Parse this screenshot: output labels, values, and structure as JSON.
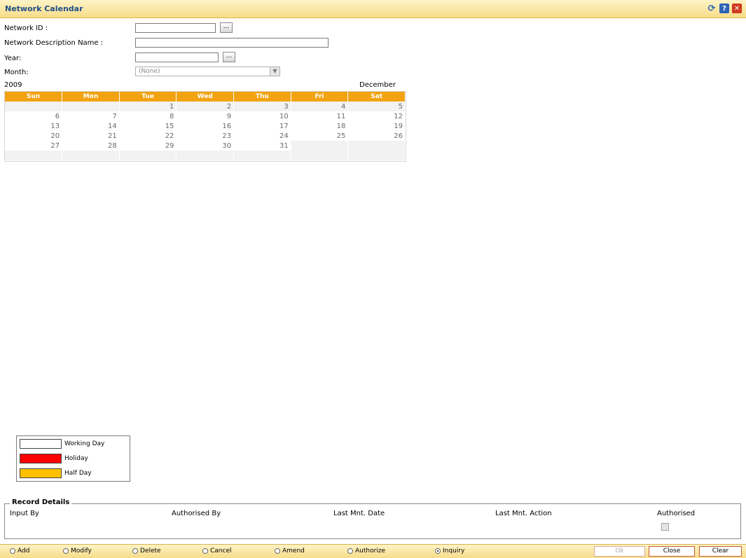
{
  "window": {
    "title": "Network Calendar"
  },
  "form": {
    "network_id_label": "Network ID :",
    "network_id_value": "",
    "network_desc_label": "Network Description Name :",
    "network_desc_value": "",
    "year_label": "Year:",
    "year_value": "",
    "month_label": "Month:",
    "month_value": "(None)",
    "lookup_label": "..."
  },
  "calendar": {
    "year": "2009",
    "month": "December",
    "days": [
      "Sun",
      "Mon",
      "Tue",
      "Wed",
      "Thu",
      "Fri",
      "Sat"
    ],
    "weeks": [
      [
        "",
        "",
        "1",
        "2",
        "3",
        "4",
        "5"
      ],
      [
        "6",
        "7",
        "8",
        "9",
        "10",
        "11",
        "12"
      ],
      [
        "13",
        "14",
        "15",
        "16",
        "17",
        "18",
        "19"
      ],
      [
        "20",
        "21",
        "22",
        "23",
        "24",
        "25",
        "26"
      ],
      [
        "27",
        "28",
        "29",
        "30",
        "31",
        "",
        ""
      ],
      [
        "",
        "",
        "",
        "",
        "",
        "",
        ""
      ]
    ]
  },
  "legend": {
    "working_day": "Working Day",
    "holiday": "Holiday",
    "half_day": "Half Day",
    "colors": {
      "working_day": "#ffffff",
      "holiday": "#ff0000",
      "half_day": "#ffc000"
    }
  },
  "record_details": {
    "title": "Record Details",
    "input_by": "Input By",
    "authorised_by": "Authorised By",
    "last_mnt_date": "Last Mnt. Date",
    "last_mnt_action": "Last Mnt. Action",
    "authorised": "Authorised"
  },
  "actions": {
    "modes": [
      "Add",
      "Modify",
      "Delete",
      "Cancel",
      "Amend",
      "Authorize",
      "Inquiry"
    ],
    "selected_mode": "Inquiry",
    "ok": "Ok",
    "close": "Close",
    "clear": "Clear"
  },
  "theme": {
    "accent": "#f2a311",
    "title_color": "#1e4f88"
  }
}
